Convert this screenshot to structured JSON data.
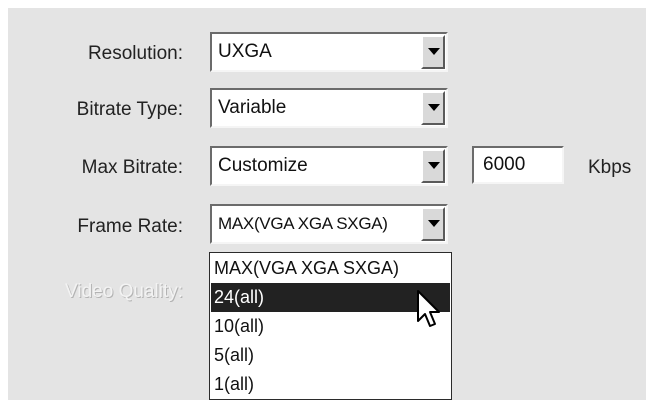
{
  "form": {
    "resolution": {
      "label": "Resolution:",
      "value": "UXGA"
    },
    "bitrate_type": {
      "label": "Bitrate Type:",
      "value": "Variable"
    },
    "max_bitrate": {
      "label": "Max Bitrate:",
      "value": "Customize",
      "custom_value": "6000",
      "unit": "Kbps"
    },
    "frame_rate": {
      "label": "Frame Rate:",
      "value": "MAX(VGA XGA SXGA)"
    },
    "video_quality": {
      "label": "Video Quality:",
      "enabled": false
    }
  },
  "frame_rate_dropdown": {
    "open": true,
    "options": [
      "MAX(VGA XGA SXGA)",
      "24(all)",
      "10(all)",
      "5(all)",
      "1(all)"
    ],
    "highlighted": "24(all)"
  },
  "colors": {
    "panel_bg": "#e4e4e4",
    "highlight_bg": "#222222",
    "highlight_text": "#ffffff"
  },
  "icons": {
    "dropdown_arrow": "chevron-down-icon",
    "pointer": "mouse-cursor-icon"
  }
}
